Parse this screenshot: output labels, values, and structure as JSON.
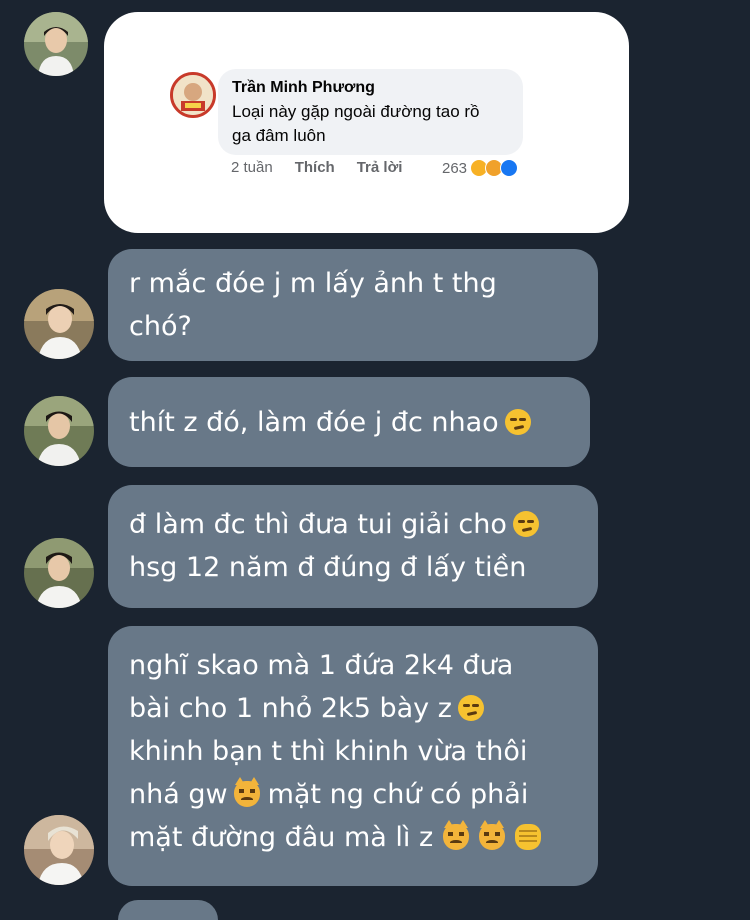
{
  "shared_comment": {
    "author": "Trần Minh Phương",
    "text_lines": [
      "Loại này gặp ngoài đường tao rồ",
      "ga đâm luôn"
    ],
    "time": "2 tuần",
    "like_label": "Thích",
    "reply_label": "Trả lời",
    "reaction_count": "263",
    "reaction_icons": [
      "haha-icon",
      "sad-icon",
      "like-icon"
    ]
  },
  "messages": [
    {
      "lines": [
        "r mắc đóe j m lấy ảnh t thg",
        "chó?"
      ],
      "emojis": []
    },
    {
      "lines": [
        "thít z đó, làm đóe j đc nhao"
      ],
      "emojis": [
        "smirk-emoji"
      ]
    },
    {
      "lines": [
        "đ làm đc thì đưa tui giải cho",
        "hsg 12 năm đ đúng đ lấy tiền"
      ],
      "emojis": [
        "smirk-emoji"
      ]
    },
    {
      "lines": [
        "nghĩ skao mà 1 đứa 2k4 đưa",
        "bài cho 1 nhỏ 2k5 bày z",
        "khinh bạn t thì khinh vừa thôi",
        "nhá gw",
        "mặt ng chứ có phải",
        "mặt đường đâu mà lì z"
      ],
      "emojis": [
        "smirk-emoji",
        "pouting-cat-emoji",
        "pouting-cat-emoji",
        "pouting-cat-emoji",
        "fist-emoji"
      ]
    }
  ],
  "colors": {
    "background": "#1b2430",
    "bubble": "#687888",
    "card": "#ffffff"
  }
}
